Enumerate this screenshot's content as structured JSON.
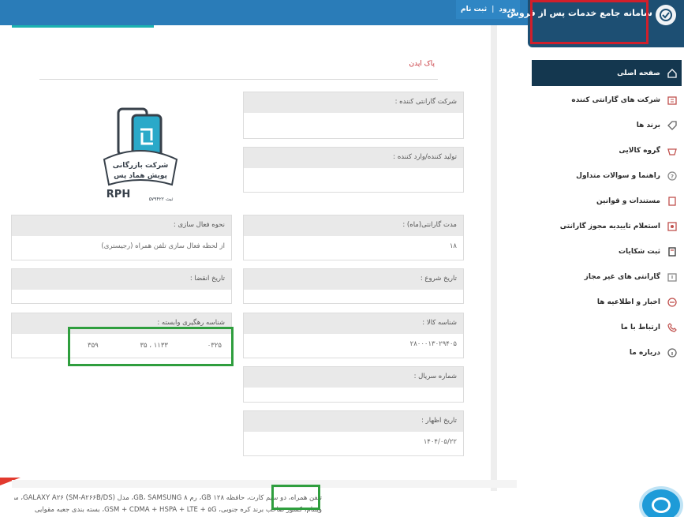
{
  "header": {
    "login_label": "ورود",
    "separator": "|",
    "register_label": "ثبت نام",
    "brand_title": "سامانه جامع خدمات پس از فروش"
  },
  "sidebar": {
    "items": [
      {
        "label": "صفحه اصلی",
        "icon": "home-icon"
      },
      {
        "label": "شرکت های گارانتی کننده",
        "icon": "building-icon"
      },
      {
        "label": "برند ها",
        "icon": "tag-icon"
      },
      {
        "label": "گروه کالایی",
        "icon": "basket-icon"
      },
      {
        "label": "راهنما و سوالات متداول",
        "icon": "help-icon"
      },
      {
        "label": "مستندات و قوانین",
        "icon": "document-icon"
      },
      {
        "label": "استعلام تاییدیه مجوز گارانتی",
        "icon": "certificate-icon"
      },
      {
        "label": "ثبت شکایات",
        "icon": "complaint-icon"
      },
      {
        "label": "گارانتی های غیر مجاز",
        "icon": "warning-icon"
      },
      {
        "label": "اخبار و اطلاعیه ها",
        "icon": "news-icon"
      },
      {
        "label": "ارتباط با ما",
        "icon": "phone-icon"
      },
      {
        "label": "درباره ما",
        "icon": "info-icon"
      }
    ]
  },
  "breadcrumb": "پاک اپدن",
  "fields": {
    "guarantor": {
      "label": "شرکت گارانتی کننده :",
      "value": ""
    },
    "producer": {
      "label": "تولید کننده/وارد کننده :",
      "value": ""
    },
    "duration": {
      "label": "مدت گارانتی(ماه) :",
      "value": "۱۸"
    },
    "activation": {
      "label": "نحوه فعال سازی :",
      "value": "از لحظه فعال سازی تلفن همراه (رجیستری)"
    },
    "start_date": {
      "label": "تاریخ شروع :",
      "value": ""
    },
    "expiry_date": {
      "label": "تاریخ انقضا :",
      "value": ""
    },
    "product_id": {
      "label": "شناسه کالا :",
      "value": "۲۸۰۰۰۱۳۰۲۹۴۰۵"
    },
    "tracking_id": {
      "label": "شناسه رهگیری وابسته :",
      "part1": "۰۳۲۵",
      "part2": "۱۱۳۳ ، ۳۵",
      "part3": "۳۵۹"
    },
    "serial": {
      "label": "شماره سریال :",
      "value": ""
    },
    "declaration_date": {
      "label": "تاریخ اظهار :",
      "value": "۱۴۰۴/۰۵/۲۲"
    }
  },
  "logo": {
    "company_name_line1": "شرکت بازرگانی",
    "company_name_line2": "پویش هماد پس",
    "brand": "RPH",
    "reg_number": "ثبت ۵۷۹۴۲۲"
  },
  "description": {
    "line1": "تلفن همراه، دو سیم کارت، حافظه ۱۲۸ GB، رم ۸ GB، SAMSUNG، مدل GALAXY A۲۶ (SM-A۲۶۶B/DS)، سازنده SAMSUNG ELECTRONICS",
    "line2": "ویتنام، کشور صاحب برند کره جنوبی، GSM + CDMA + HSPA + LTE + ۵G، بسته بندی جعبه مقوایی"
  },
  "colors": {
    "topbar": "#2a7cb8",
    "brand_bg": "#1d4f73",
    "sidebar_active": "#14374f",
    "accent": "#1bb2b0",
    "highlight_red": "#d01f2b",
    "highlight_green": "#2f9e3e"
  }
}
